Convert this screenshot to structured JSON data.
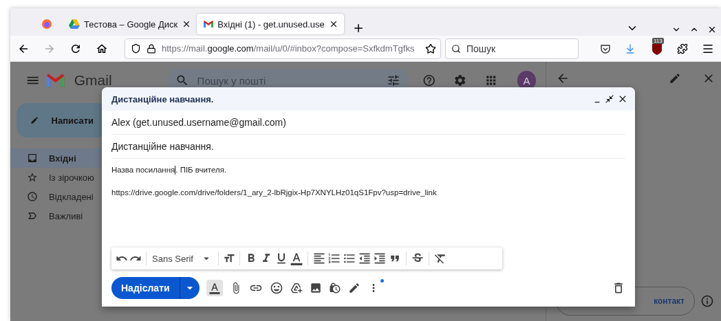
{
  "browser": {
    "tabs": [
      {
        "title": "Тестова – Google Диск",
        "kind": "drive",
        "selected": false
      },
      {
        "title": "Вхідні (1) - get.unused.use",
        "kind": "gmail",
        "selected": true
      }
    ],
    "forward_disabled": true,
    "url": {
      "scheme": "https://mail.",
      "domain": "google.com",
      "path": "/mail/u/0/#inbox?compose=SxfkdmTgfks"
    },
    "search": {
      "placeholder": "Пошук"
    },
    "extension_badge": "113"
  },
  "gmail": {
    "logo": "Gmail",
    "search": {
      "placeholder": "Пошук у пошті"
    },
    "avatar": "A",
    "compose": "Написати",
    "nav": [
      {
        "label": "Вхідні",
        "kind": "inbox",
        "selected": true
      },
      {
        "label": "Із зірочкою",
        "kind": "starred",
        "selected": false
      },
      {
        "label": "Відкладені",
        "kind": "snoozed",
        "selected": false
      },
      {
        "label": "Важливі",
        "kind": "important",
        "selected": false
      }
    ],
    "side_panel": {
      "contact_button": "контакт"
    }
  },
  "compose": {
    "title": "Дистанційне навчання.",
    "to": "Alex (get.unused.username@gmail.com)",
    "subject": "Дистанційне навчання.",
    "body": [
      {
        "before_caret": "Назва посилання",
        "after_caret": ". ПІБ вчителя.",
        "caret": true
      },
      {
        "before_caret": "https://drive.google.com/drive/folders/1_ary_2-lbRjgix-Hp7XNYLHz01qS1Fpv?usp=drive_link",
        "caret": false
      }
    ],
    "font": "Sans Serif",
    "send": "Надіслати",
    "formatting_selected": true,
    "more_has_dot": true
  }
}
